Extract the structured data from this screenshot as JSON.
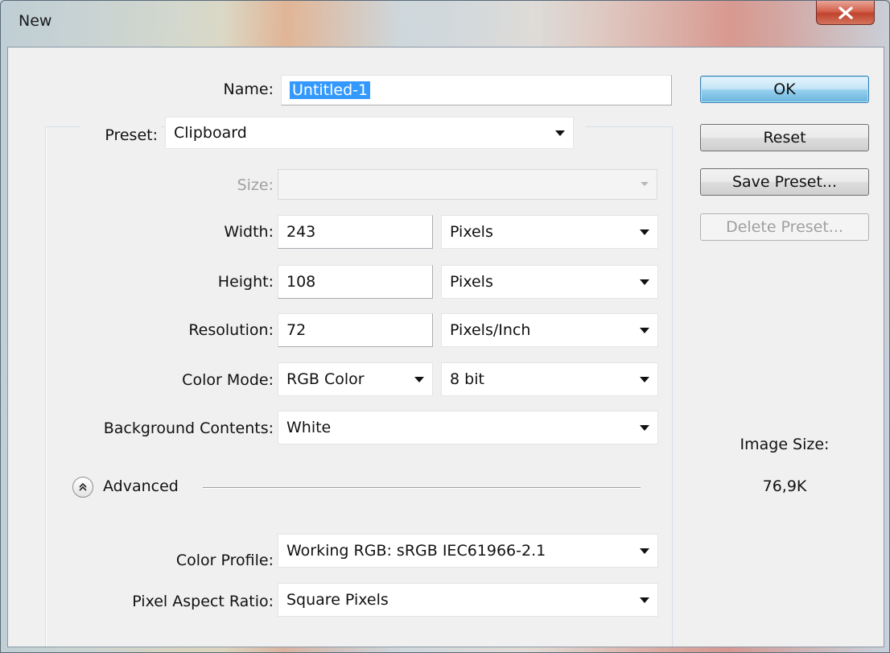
{
  "window": {
    "title": "New",
    "close_label": "X"
  },
  "form": {
    "name_label": "Name:",
    "name_value": "Untitled-1",
    "preset_label": "Preset:",
    "preset_value": "Clipboard",
    "size_label": "Size:",
    "size_value": "",
    "width_label": "Width:",
    "width_value": "243",
    "width_unit": "Pixels",
    "height_label": "Height:",
    "height_value": "108",
    "height_unit": "Pixels",
    "resolution_label": "Resolution:",
    "resolution_value": "72",
    "resolution_unit": "Pixels/Inch",
    "color_mode_label": "Color Mode:",
    "color_mode_value": "RGB Color",
    "bit_depth_value": "8 bit",
    "background_label": "Background Contents:",
    "background_value": "White",
    "advanced_label": "Advanced",
    "color_profile_label": "Color Profile:",
    "color_profile_value": "Working RGB:  sRGB IEC61966-2.1",
    "pixel_aspect_label": "Pixel Aspect Ratio:",
    "pixel_aspect_value": "Square Pixels"
  },
  "buttons": {
    "ok": "OK",
    "reset": "Reset",
    "save_preset": "Save Preset...",
    "delete_preset": "Delete Preset..."
  },
  "image_size": {
    "label": "Image Size:",
    "value": "76,9K"
  },
  "colors": {
    "selection": "#3399ff",
    "close_button": "#c8472f",
    "default_button": "#98d1ef"
  },
  "icons": {
    "close": "close-icon",
    "dropdown": "chevron-down-icon",
    "advanced_toggle": "double-chevron-up-icon"
  }
}
